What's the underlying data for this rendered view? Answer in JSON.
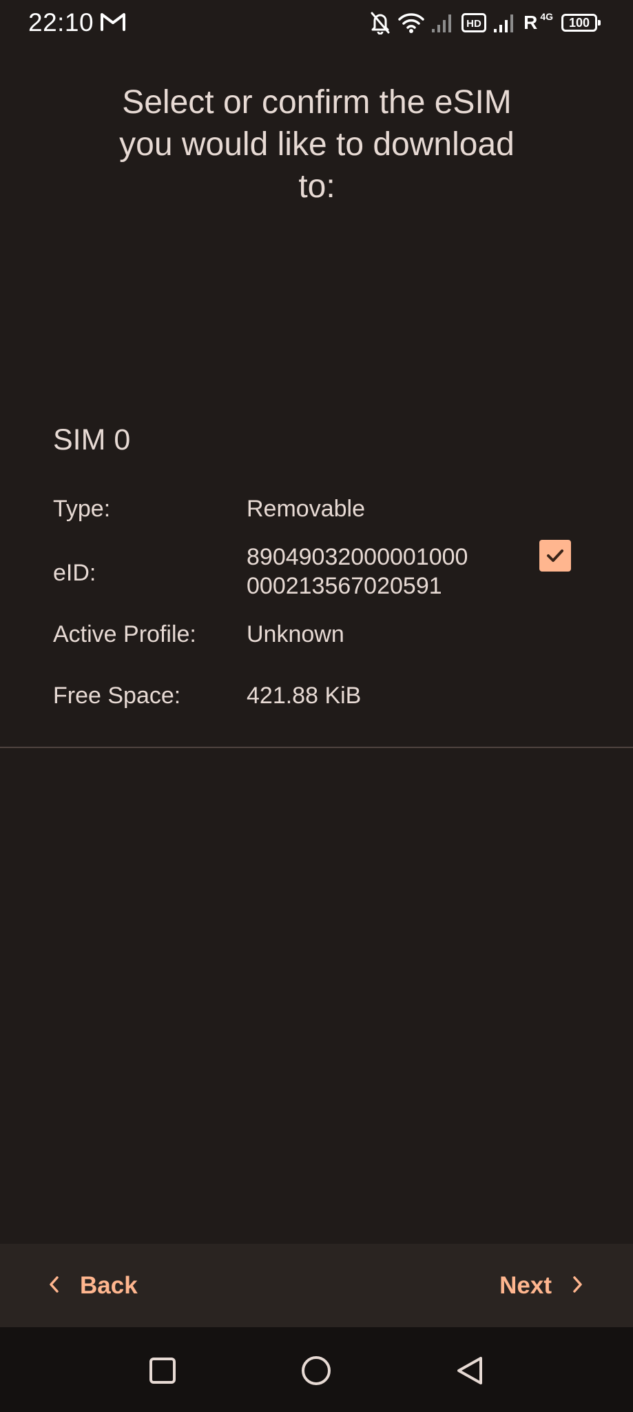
{
  "status_bar": {
    "time": "22:10",
    "hd_label": "HD",
    "roaming_label": "R",
    "network_type": "4G",
    "battery_level": "100",
    "icons": [
      "gmail-icon",
      "notifications-off-icon",
      "wifi-icon",
      "signal-icon",
      "hd-icon",
      "signal-icon",
      "battery-icon"
    ]
  },
  "page": {
    "title": "Select or confirm the eSIM you would like to download to:"
  },
  "sim": {
    "name": "SIM 0",
    "rows": [
      {
        "label": "Type:",
        "value": "Removable"
      },
      {
        "label": "eID:",
        "value_line1": "89049032000001000",
        "value_line2": "000213567020591"
      },
      {
        "label": "Active Profile:",
        "value": "Unknown"
      },
      {
        "label": "Free Space:",
        "value": "421.88 KiB"
      }
    ],
    "selected": true
  },
  "footer": {
    "back_label": "Back",
    "next_label": "Next"
  },
  "nav": {
    "icons": [
      "recents-icon",
      "home-icon",
      "back-icon"
    ]
  },
  "colors": {
    "background": "#201b19",
    "accent": "#ffb68f",
    "text": "#e7dad4",
    "footer_bg": "#2a2421",
    "navbar_bg": "#141110"
  }
}
